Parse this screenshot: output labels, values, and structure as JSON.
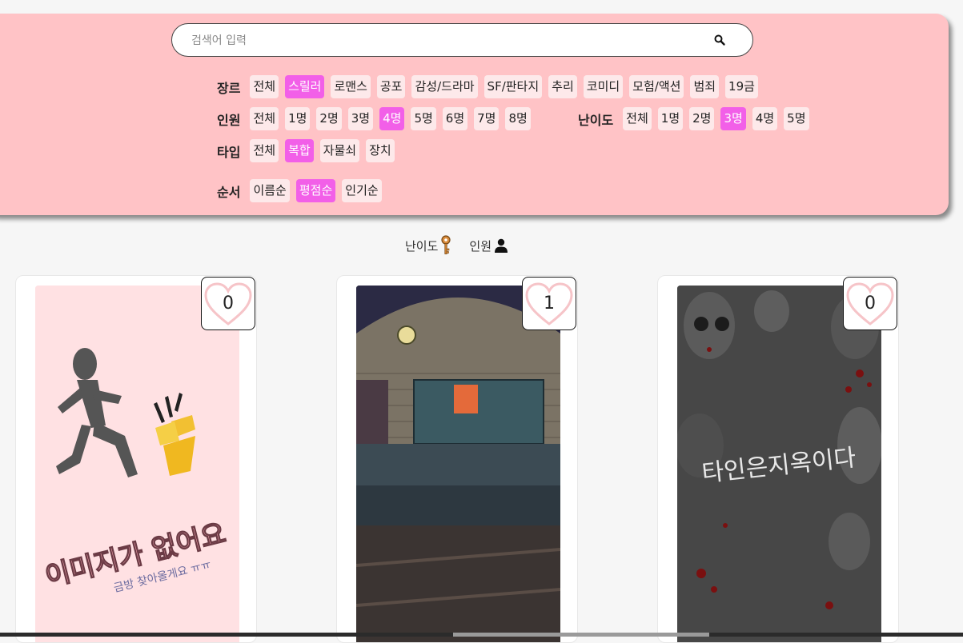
{
  "search": {
    "placeholder": "검색어 입력"
  },
  "filters": {
    "genre": {
      "label": "장르",
      "options": [
        "전체",
        "스릴러",
        "로맨스",
        "공포",
        "감성/드라마",
        "SF/판타지",
        "추리",
        "코미디",
        "모험/액션",
        "범죄",
        "19금"
      ],
      "selected": "스릴러"
    },
    "people": {
      "label": "인원",
      "options": [
        "전체",
        "1명",
        "2명",
        "3명",
        "4명",
        "5명",
        "6명",
        "7명",
        "8명"
      ],
      "selected": "4명"
    },
    "difficulty": {
      "label": "난이도",
      "options": [
        "전체",
        "1명",
        "2명",
        "3명",
        "4명",
        "5명"
      ],
      "selected": "3명"
    },
    "type": {
      "label": "타입",
      "options": [
        "전체",
        "복합",
        "자물쇠",
        "장치"
      ],
      "selected": "복합"
    },
    "order": {
      "label": "순서",
      "options": [
        "이름순",
        "평점순",
        "인기순"
      ],
      "selected": "평점순"
    }
  },
  "legend": {
    "difficulty_label": "난이도",
    "people_label": "인원"
  },
  "cards": [
    {
      "likes": "0",
      "poster_text": "이미지가 없어요",
      "poster_sub": "금방 찾아올게요 ㅠㅠ"
    },
    {
      "likes": "1"
    },
    {
      "likes": "0",
      "poster_text": "타인은지옥이다"
    }
  ],
  "colors": {
    "panel": "#ffc3c6",
    "chip": "#fde9ea",
    "active": "#f25fe8"
  }
}
